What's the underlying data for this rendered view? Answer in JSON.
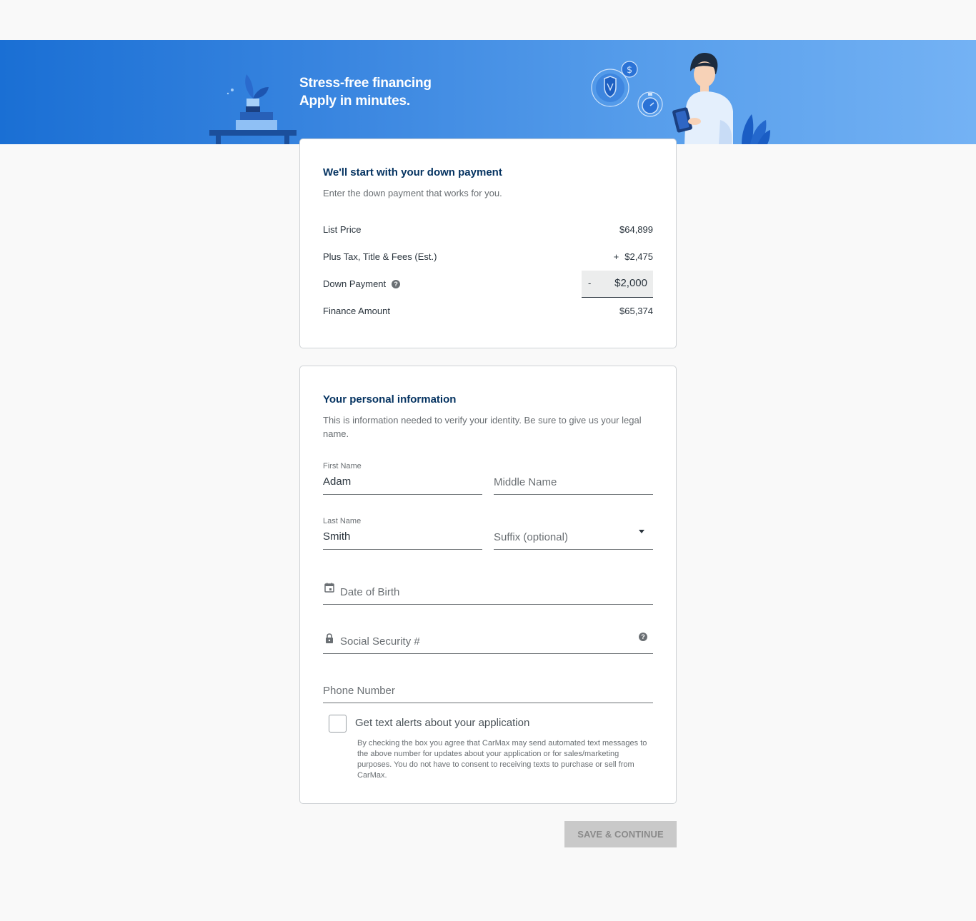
{
  "banner": {
    "line1": "Stress-free financing",
    "line2": "Apply in minutes."
  },
  "down_payment": {
    "title": "We'll start with your down payment",
    "subtitle": "Enter the down payment that works for you.",
    "rows": {
      "list_price_label": "List Price",
      "list_price_value": "$64,899",
      "tax_label": "Plus Tax, Title & Fees (Est.)",
      "tax_sign": "+",
      "tax_value": "$2,475",
      "down_label": "Down Payment",
      "down_sign": "-",
      "down_value": "$2,000",
      "finance_label": "Finance Amount",
      "finance_value": "$65,374"
    }
  },
  "personal": {
    "title": "Your personal information",
    "subtitle": "This is information needed to verify your identity. Be sure to give us your legal name.",
    "first_name_label": "First Name",
    "first_name_value": "Adam",
    "middle_name_placeholder": "Middle Name",
    "last_name_label": "Last Name",
    "last_name_value": "Smith",
    "suffix_placeholder": "Suffix (optional)",
    "dob_placeholder": "Date of Birth",
    "ssn_placeholder": "Social Security #",
    "phone_placeholder": "Phone Number",
    "text_alerts_label": "Get text alerts about your application",
    "disclaimer": "By checking the box you agree that CarMax may send automated text messages to the above number for updates about your application or for sales/marketing purposes. You do not have to consent to receiving texts to purchase or sell from CarMax."
  },
  "actions": {
    "save_label": "SAVE & CONTINUE"
  },
  "icons": {
    "help": "question-circle-icon",
    "calendar": "calendar-icon",
    "lock": "lock-icon",
    "dropdown": "caret-down-icon"
  },
  "colors": {
    "banner_start": "#1a6fd4",
    "banner_end": "#74b2f4",
    "heading": "#053361",
    "button_disabled": "#c9c9c9"
  }
}
